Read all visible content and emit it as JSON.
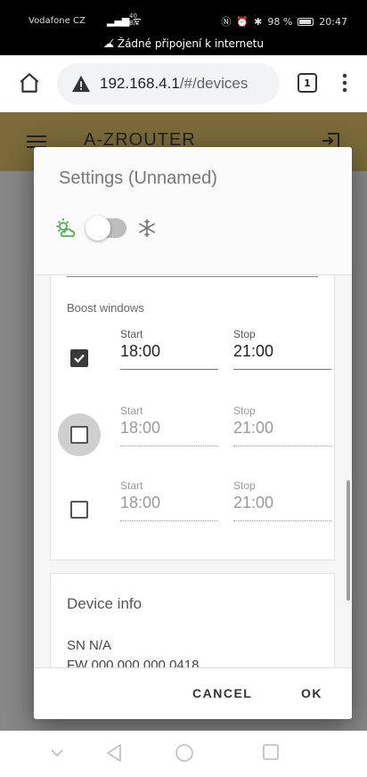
{
  "status_bar": {
    "carrier": "Vodafone CZ",
    "speed": "40\nB/s",
    "battery": "98 %",
    "time": "20:47",
    "offline_notice": "Žádné připojení k internetu"
  },
  "browser": {
    "url_host": "192.168.4.1",
    "url_path": "/#/devices",
    "tab_count": "1"
  },
  "app": {
    "title": "A-ZROUTER"
  },
  "dialog": {
    "title": "Settings (Unnamed)",
    "boost_label": "Boost windows",
    "windows": [
      {
        "checked": true,
        "start_label": "Start",
        "start": "18:00",
        "stop_label": "Stop",
        "stop": "21:00"
      },
      {
        "checked": false,
        "start_label": "Start",
        "start": "18:00",
        "stop_label": "Stop",
        "stop": "21:00"
      },
      {
        "checked": false,
        "start_label": "Start",
        "start": "18:00",
        "stop_label": "Stop",
        "stop": "21:00"
      }
    ],
    "device_info_title": "Device info",
    "sn": "SN N/A",
    "fw": "FW 000.000.000.0418",
    "cancel": "CANCEL",
    "ok": "OK"
  },
  "colors": {
    "header_bg": "#7a6a3a",
    "sun_icon": "#4caf50",
    "checkbox_checked": "#3a3a3a"
  },
  "icons": [
    "home-icon",
    "warning-icon",
    "tabs-icon",
    "more-vert-icon",
    "menu-icon",
    "logout-icon",
    "sun-cloud-icon",
    "snowflake-icon",
    "back-icon",
    "home-circle-icon",
    "recents-icon",
    "hide-keyboard-icon"
  ]
}
